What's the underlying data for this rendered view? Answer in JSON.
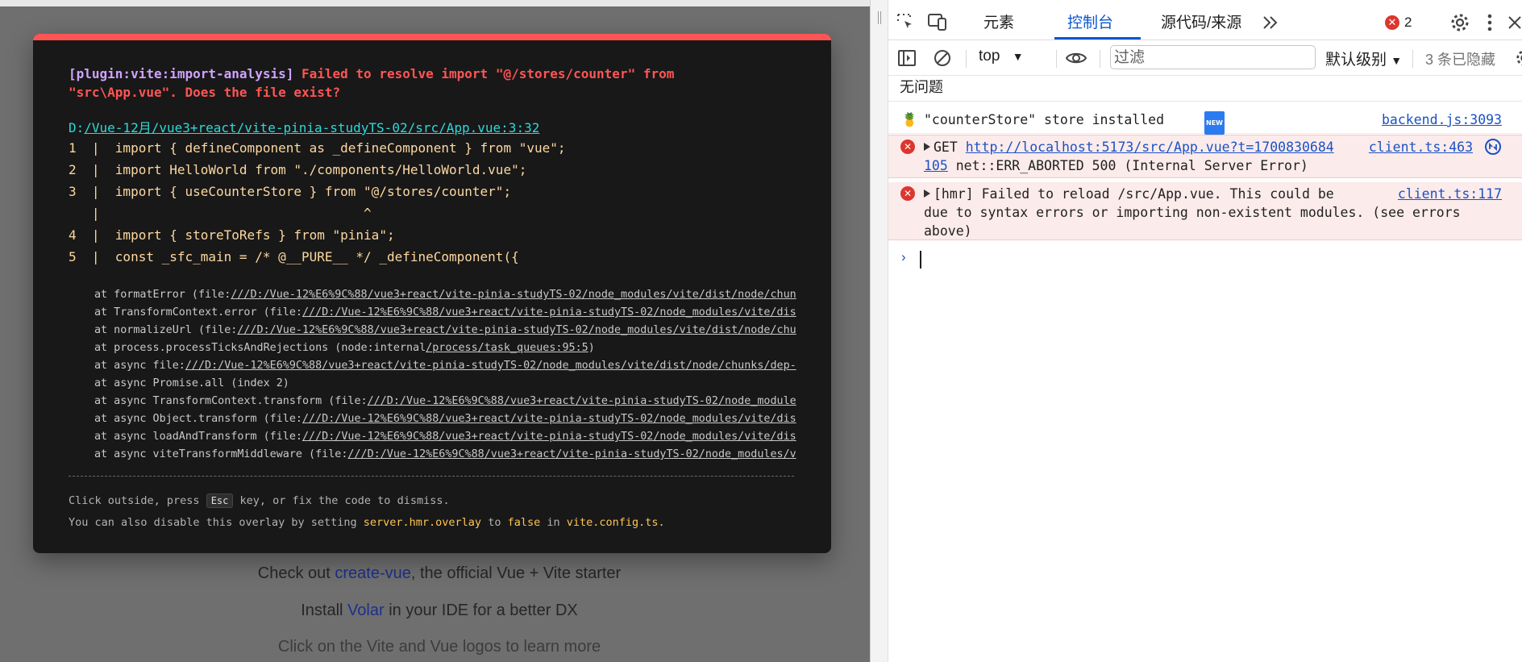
{
  "page": {
    "line1_before": "Check out ",
    "line1_link": "create-vue",
    "line1_after": ", the official Vue + Vite starter",
    "line2_before": "Install ",
    "line2_link": "Volar",
    "line2_after": " in your IDE for a better DX",
    "line3": "Click on the Vite and Vue logos to learn more"
  },
  "overlay": {
    "plugin": "[plugin:vite:import-analysis]",
    "message": " Failed to resolve import \"@/stores/counter\" from\n\"src\\App.vue\". Does the file exist?",
    "file_prefix": "D:",
    "file_path": "/Vue-12月/vue3+react/vite-pinia-studyTS-02/src/App.vue:3:32",
    "frame": [
      "1  |  import { defineComponent as _defineComponent } from \"vue\";",
      "2  |  import HelloWorld from \"./components/HelloWorld.vue\";",
      "3  |  import { useCounterStore } from \"@/stores/counter\";",
      "   |                                  ^",
      "4  |  import { storeToRefs } from \"pinia\";",
      "5  |  const _sfc_main = /* @__PURE__ */ _defineComponent({"
    ],
    "stack": [
      {
        "pre": "at formatError (file:",
        "link": "///D:/Vue-12%E6%9C%88/vue3+react/vite-pinia-studyTS-02/node_modules/vite/dist/node/chun"
      },
      {
        "pre": "at TransformContext.error (file:",
        "link": "///D:/Vue-12%E6%9C%88/vue3+react/vite-pinia-studyTS-02/node_modules/vite/dis"
      },
      {
        "pre": "at normalizeUrl (file:",
        "link": "///D:/Vue-12%E6%9C%88/vue3+react/vite-pinia-studyTS-02/node_modules/vite/dist/node/chu"
      },
      {
        "pre": "at process.processTicksAndRejections (node:internal",
        "link": "/process/task_queues:95:5",
        "post": ")"
      },
      {
        "pre": "at async file:",
        "link": "///D:/Vue-12%E6%9C%88/vue3+react/vite-pinia-studyTS-02/node_modules/vite/dist/node/chunks/dep-"
      },
      {
        "pre": "at async Promise.all (index 2)",
        "link": ""
      },
      {
        "pre": "at async TransformContext.transform (file:",
        "link": "///D:/Vue-12%E6%9C%88/vue3+react/vite-pinia-studyTS-02/node_module"
      },
      {
        "pre": "at async Object.transform (file:",
        "link": "///D:/Vue-12%E6%9C%88/vue3+react/vite-pinia-studyTS-02/node_modules/vite/dis"
      },
      {
        "pre": "at async loadAndTransform (file:",
        "link": "///D:/Vue-12%E6%9C%88/vue3+react/vite-pinia-studyTS-02/node_modules/vite/dis"
      },
      {
        "pre": "at async viteTransformMiddleware (file:",
        "link": "///D:/Vue-12%E6%9C%88/vue3+react/vite-pinia-studyTS-02/node_modules/v"
      }
    ],
    "tip_click_before": "Click outside, press ",
    "tip_key": "Esc",
    "tip_click_after": " key, or fix the code to dismiss.",
    "tip_disable_1": "You can also disable this overlay by setting ",
    "tip_setting": "server.hmr.overlay",
    "tip_disable_2": " to ",
    "tip_false": "false",
    "tip_disable_3": " in ",
    "tip_config": "vite.config.ts."
  },
  "devtools": {
    "tabs": {
      "elements": "元素",
      "console": "控制台",
      "sources": "源代码/来源"
    },
    "error_count": "2",
    "context": "top",
    "filter_placeholder": "过滤",
    "level": "默认级别",
    "hidden": "3 条已隐藏",
    "no_issues": "无问题",
    "messages": [
      {
        "icon": "pineapple",
        "text": "\"counterStore\" store installed",
        "badge": "NEW",
        "source": "backend.js:3093"
      },
      {
        "method": "GET",
        "url": "http://localhost:5173/src/App.vue?t=1700830684",
        "url_cont": "105",
        "rest": " net::ERR_ABORTED 500 (Internal Server Error)",
        "source": "client.ts:463"
      },
      {
        "line1": "[hmr] Failed to reload /src/App.vue. This could be",
        "line2": "due to syntax errors or importing non-existent modules. (see errors",
        "line3": "above)",
        "source": "client.ts:117"
      }
    ],
    "prompt": "›"
  },
  "colors": {
    "overlay_accent": "#ff5555",
    "plugin": "#cfa3ff",
    "file": "#2dd9da",
    "frame": "#fdd8a0",
    "devtools_accent": "#0b57d0",
    "error": "#dc362e"
  }
}
